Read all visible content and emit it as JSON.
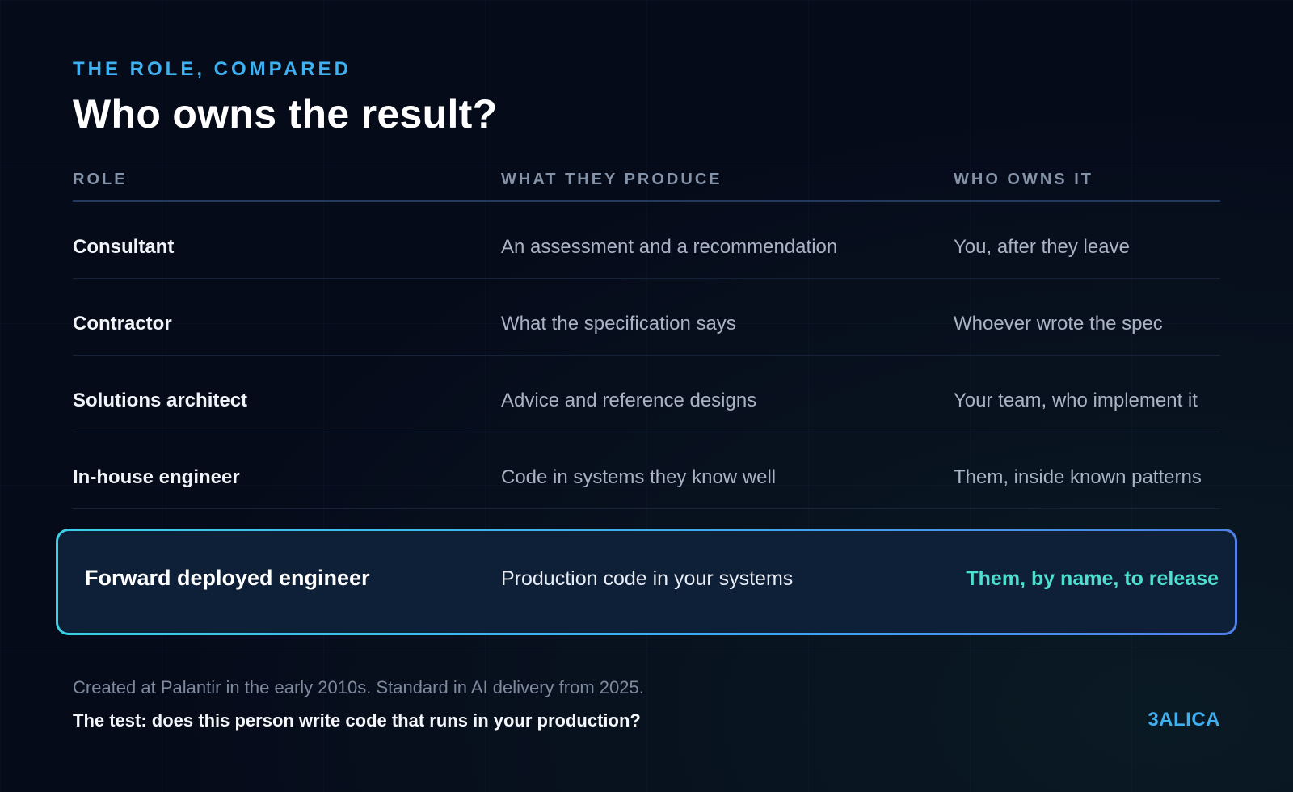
{
  "header": {
    "eyebrow": "THE ROLE, COMPARED",
    "title": "Who owns the result?"
  },
  "table": {
    "headers": [
      "ROLE",
      "WHAT THEY PRODUCE",
      "WHO OWNS IT"
    ],
    "rows": [
      {
        "role": "Consultant",
        "produce": "An assessment and a recommendation",
        "owner": "You, after they leave"
      },
      {
        "role": "Contractor",
        "produce": "What the specification says",
        "owner": "Whoever wrote the spec"
      },
      {
        "role": "Solutions architect",
        "produce": "Advice and reference designs",
        "owner": "Your team, who implement it"
      },
      {
        "role": "In-house engineer",
        "produce": "Code in systems they know well",
        "owner": "Them, inside known patterns"
      }
    ],
    "highlight": {
      "role": "Forward deployed engineer",
      "produce": "Production code in your systems",
      "owner": "Them, by name, to release"
    }
  },
  "footer": {
    "note": "Created at Palantir in the early 2010s. Standard in AI delivery from 2025.",
    "test": "The test: does this person write code that runs in your production?",
    "brand": "3ALICA"
  },
  "colors": {
    "background": "#060b1a",
    "accent": "#3fb0f0",
    "highlight_text": "#4ee0cf",
    "highlight_border": "#3ad0e6"
  }
}
